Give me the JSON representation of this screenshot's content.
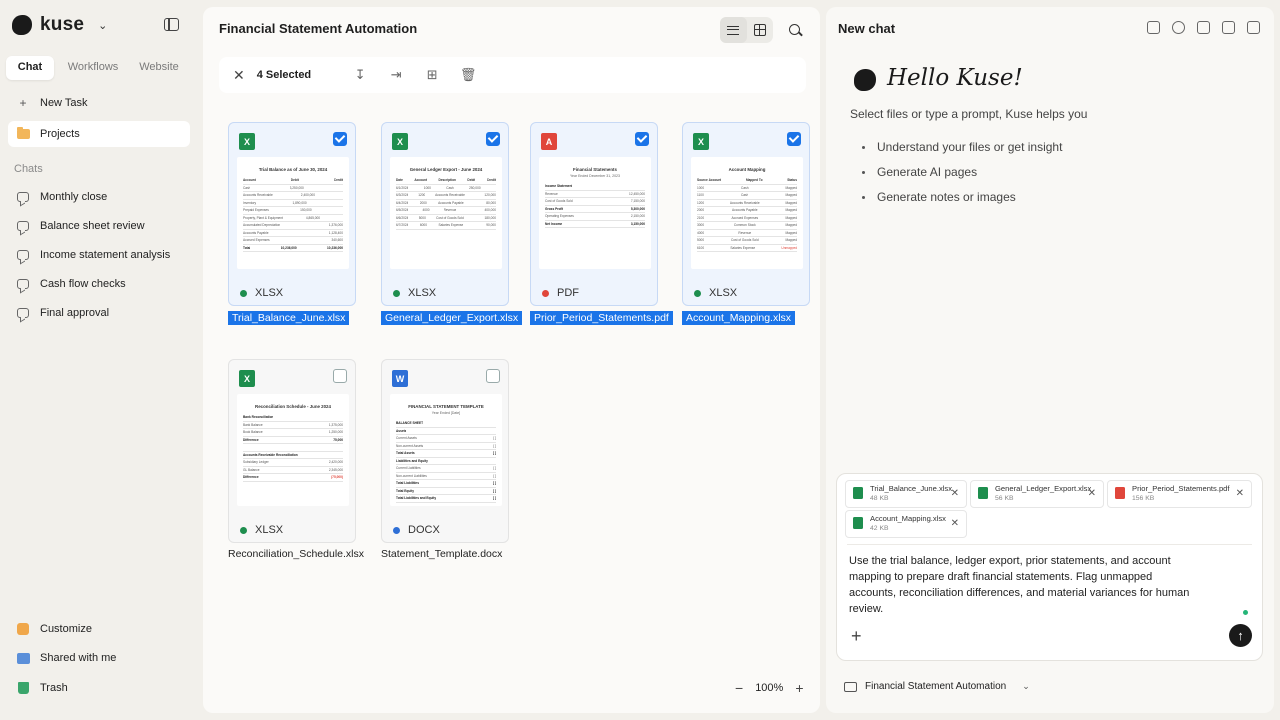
{
  "app": {
    "name": "kuse"
  },
  "sidebar": {
    "mode_tabs": [
      "Chat",
      "Workflows",
      "Website"
    ],
    "new_task": "New Task",
    "projects": "Projects",
    "chats_label": "Chats",
    "chats": [
      "Monthly close",
      "Balance sheet review",
      "Income statement analysis",
      "Cash flow checks",
      "Final approval"
    ],
    "footer": [
      "Customize",
      "Shared with me",
      "Trash"
    ]
  },
  "files": {
    "title": "Financial Statement Automation",
    "selected_label": "4 Selected",
    "zoom": "100%",
    "colors": {
      "xlsx": "#1e8e4e",
      "pdf": "#e0463b",
      "docx": "#2e6fd6",
      "selection": "#1b74e8"
    },
    "items": [
      {
        "name": "Trial_Balance_June.xlsx",
        "type": "XLSX",
        "badge": "X",
        "preview": {
          "title": "Trial Balance as of June 30, 2024",
          "rows": [
            [
              "Account",
              "Debit",
              "Credit"
            ],
            [
              "Cash",
              "3,250,000",
              ""
            ],
            [
              "Accounts Receivable",
              "2,400,000",
              ""
            ],
            [
              "Inventory",
              "1,890,000",
              ""
            ],
            [
              "Prepaid Expenses",
              "150,000",
              ""
            ],
            [
              "Property, Plant & Equipment",
              "4,865,000",
              ""
            ],
            [
              "Accumulated Depreciation",
              "",
              "1,376,000"
            ],
            [
              "Accounts Payable",
              "",
              "1,128,400"
            ],
            [
              "Accrued Expenses",
              "",
              "340,600"
            ],
            [
              "Total",
              "10,236,000",
              "10,236,000"
            ]
          ]
        }
      },
      {
        "name": "General_Ledger_Export.xlsx",
        "type": "XLSX",
        "badge": "X",
        "preview": {
          "title": "General Ledger Export - June 2024",
          "rows": [
            [
              "Date",
              "Account",
              "Description",
              "Debit",
              "Credit"
            ],
            [
              "6/1/2024",
              "1000",
              "Cash",
              "250,000",
              ""
            ],
            [
              "6/3/2024",
              "1200",
              "Accounts Receivable",
              "",
              "120,000"
            ],
            [
              "6/4/2024",
              "2000",
              "Accounts Payable",
              "",
              "80,000"
            ],
            [
              "6/5/2024",
              "4000",
              "Revenue",
              "",
              "400,000"
            ],
            [
              "6/6/2024",
              "5000",
              "Cost of Goods Sold",
              "",
              "180,000"
            ],
            [
              "6/7/2024",
              "6000",
              "Salaries Expense",
              "",
              "90,000"
            ]
          ]
        }
      },
      {
        "name": "Prior_Period_Statements.pdf",
        "type": "PDF",
        "badge": "A",
        "preview": {
          "title": "Financial Statements",
          "subtitle": "Year Ended December 31, 2023",
          "rows": [
            [
              "Income Statement",
              ""
            ],
            [
              "Revenue",
              "12,450,000"
            ],
            [
              "Cost of Goods Sold",
              "7,150,000"
            ],
            [
              "Gross Profit",
              "5,300,000"
            ],
            [
              "Operating Expenses",
              "2,150,000"
            ],
            [
              "Net Income",
              "3,150,000"
            ]
          ]
        }
      },
      {
        "name": "Account_Mapping.xlsx",
        "type": "XLSX",
        "badge": "X",
        "preview": {
          "title": "Account Mapping",
          "rows": [
            [
              "Source Account",
              "Mapped To",
              "Status"
            ],
            [
              "1000",
              "Cash",
              "Mapped"
            ],
            [
              "1100",
              "Cash",
              "Mapped"
            ],
            [
              "1200",
              "Accounts Receivable",
              "Mapped"
            ],
            [
              "2000",
              "Accounts Payable",
              "Mapped"
            ],
            [
              "2100",
              "Accrued Expenses",
              "Mapped"
            ],
            [
              "3000",
              "Common Stock",
              "Mapped"
            ],
            [
              "4000",
              "Revenue",
              "Mapped"
            ],
            [
              "5000",
              "Cost of Goods Sold",
              "Mapped"
            ],
            [
              "6100",
              "Salaries Expense",
              "Unmapped"
            ]
          ]
        }
      },
      {
        "name": "Reconciliation_Schedule.xlsx",
        "type": "XLSX",
        "badge": "X",
        "preview": {
          "title": "Reconciliation Schedule - June 2024",
          "rows": [
            [
              "Bank Reconciliation",
              ""
            ],
            [
              "Bank Balance",
              "1,375,000"
            ],
            [
              "Book Balance",
              "1,250,000"
            ],
            [
              "Difference",
              "75,000"
            ],
            [
              "",
              ""
            ],
            [
              "Accounts Receivable Reconciliation",
              ""
            ],
            [
              "Subsidiary Ledger",
              "2,420,000"
            ],
            [
              "GL Balance",
              "2,345,000"
            ],
            [
              "Difference",
              "(75,000)"
            ]
          ]
        }
      },
      {
        "name": "Statement_Template.docx",
        "type": "DOCX",
        "badge": "W",
        "preview": {
          "title": "FINANCIAL STATEMENT TEMPLATE",
          "subtitle": "Year Ended [Date]",
          "rows": [
            [
              "BALANCE SHEET",
              ""
            ],
            [
              "Assets",
              ""
            ],
            [
              "Current Assets",
              "[ ]"
            ],
            [
              "Non-current Assets",
              "[ ]"
            ],
            [
              "Total Assets",
              "[ ]"
            ],
            [
              "Liabilities and Equity",
              ""
            ],
            [
              "Current Liabilities",
              "[ ]"
            ],
            [
              "Non-current Liabilities",
              "[ ]"
            ],
            [
              "Total Liabilities",
              "[ ]"
            ],
            [
              "Total Equity",
              "[ ]"
            ],
            [
              "Total Liabilities and Equity",
              "[ ]"
            ]
          ]
        }
      }
    ]
  },
  "chat": {
    "title": "New chat",
    "greeting": "Hello Kuse!",
    "lead": "Select files or type a prompt, Kuse helps you",
    "bullets": [
      "Understand your files or get insight",
      "Generate AI pages",
      "Generate notes or images"
    ],
    "attachments": [
      {
        "name": "Trial_Balance_June.xlsx",
        "size": "48 KB"
      },
      {
        "name": "General_Ledger_Export.xlsx",
        "size": "56 KB"
      },
      {
        "name": "Prior_Period_Statements.pdf",
        "size": "156 KB"
      },
      {
        "name": "Account_Mapping.xlsx",
        "size": "42 KB"
      }
    ],
    "prompt": "Use the trial balance, ledger export, prior statements, and account mapping to prepare draft financial statements. Flag unmapped accounts, reconciliation differences, and material variances for human review.",
    "project": "Financial Statement Automation"
  }
}
